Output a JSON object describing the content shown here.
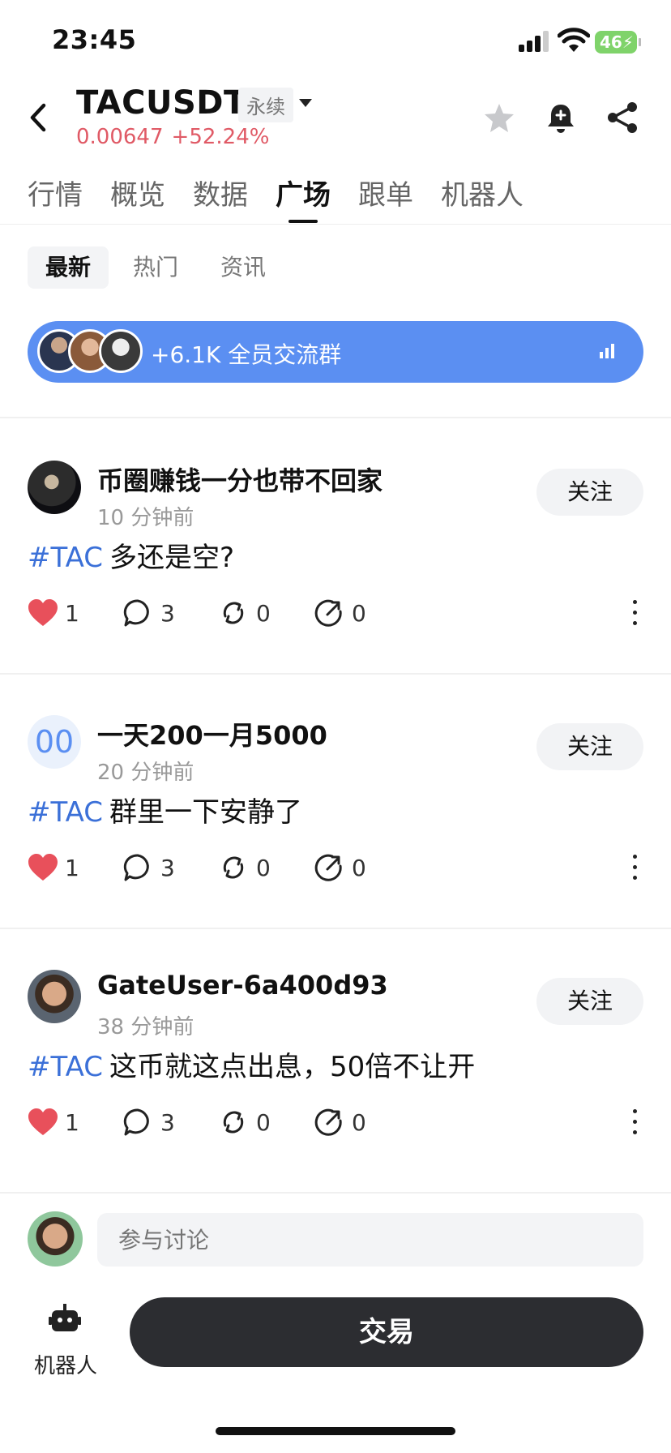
{
  "status_bar": {
    "time": "23:45",
    "battery": "46"
  },
  "header": {
    "title": "TACUSDT",
    "badge": "永续",
    "price": "0.00647",
    "change": "+52.24%",
    "price_color": "#e05a66"
  },
  "tabs": [
    {
      "label": "行情"
    },
    {
      "label": "概览"
    },
    {
      "label": "数据"
    },
    {
      "label": "广场",
      "active": true
    },
    {
      "label": "跟单"
    },
    {
      "label": "机器人"
    }
  ],
  "subtabs": [
    {
      "label": "最新",
      "active": true
    },
    {
      "label": "热门"
    },
    {
      "label": "资讯"
    }
  ],
  "group_banner": {
    "text": "+6.1K 全员交流群",
    "color": "#5b8ff2"
  },
  "posts": [
    {
      "username": "币圈赚钱一分也带不回家",
      "time": "10 分钟前",
      "follow_label": "关注",
      "hashtag": "#TAC",
      "text": "多还是空?",
      "likes": "1",
      "comments": "3",
      "reposts": "0",
      "shares": "0"
    },
    {
      "username": "一天200一月5000",
      "avatar_text": "00",
      "time": "20 分钟前",
      "follow_label": "关注",
      "hashtag": "#TAC",
      "text": "群里一下安静了",
      "likes": "1",
      "comments": "3",
      "reposts": "0",
      "shares": "0"
    },
    {
      "username": "GateUser-6a400d93",
      "time": "38 分钟前",
      "follow_label": "关注",
      "hashtag": "#TAC",
      "text": "这币就这点出息，50倍不让开",
      "likes": "1",
      "comments": "3",
      "reposts": "0",
      "shares": "0"
    }
  ],
  "comment_bar": {
    "placeholder": "参与讨论"
  },
  "bottom": {
    "robot_label": "机器人",
    "trade_label": "交易"
  },
  "colors": {
    "hashtag": "#3b70d8",
    "like": "#e8505b",
    "trade_button": "#2c2d31"
  }
}
